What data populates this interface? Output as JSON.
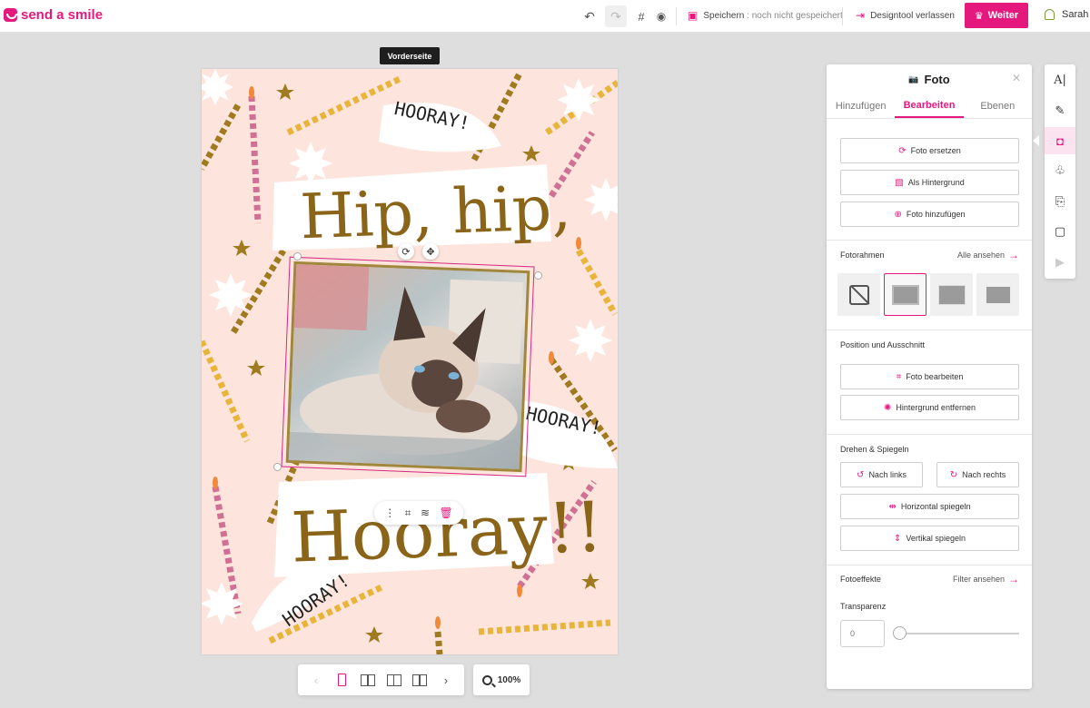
{
  "brand": {
    "name": "send a smile",
    "color": "#e5197d"
  },
  "toolbar": {
    "undo_icon": "undo-icon",
    "redo_icon": "redo-icon",
    "grid_icon": "grid-icon",
    "preview_icon": "eye-icon",
    "save_label": "Speichern",
    "save_status": ": noch nicht gespeichert",
    "exit_label": "Designtool verlassen",
    "next_label": "Weiter",
    "user_name": "Sarah"
  },
  "canvas": {
    "page_label": "Vorderseite",
    "texts": {
      "hip": "Hip, hip,",
      "hooray_big": "Hooray!!",
      "hooray_small_1": "HOORAY!",
      "hooray_small_2": "HOORAY!",
      "hooray_small_3": "HOORAY!"
    }
  },
  "bottom_bar": {
    "zoom": "100%"
  },
  "panel": {
    "title": "Foto",
    "tabs": [
      "Hinzufügen",
      "Bearbeiten",
      "Ebenen"
    ],
    "active_tab": "Bearbeiten",
    "buttons": {
      "replace": "Foto ersetzen",
      "background": "Als Hintergrund",
      "add": "Foto hinzufügen"
    },
    "frames": {
      "label": "Fotorahmen",
      "link": "Alle ansehen"
    },
    "position": {
      "label": "Position und Ausschnitt",
      "edit": "Foto bearbeiten",
      "remove_bg": "Hintergrund entfernen"
    },
    "rotate": {
      "label": "Drehen & Spiegeln",
      "left": "Nach links",
      "right": "Nach rechts",
      "hflip": "Horizontal spiegeln",
      "vflip": "Vertikal spiegeln"
    },
    "effects": {
      "label": "Fotoeffekte",
      "link": "Filter ansehen"
    },
    "transparency": {
      "label": "Transparenz",
      "value": "0"
    }
  },
  "rail": [
    "text-tool-icon",
    "draw-tool-icon",
    "photo-tool-icon",
    "shapes-tool-icon",
    "import-tool-icon",
    "frame-tool-icon",
    "play-tool-icon"
  ]
}
